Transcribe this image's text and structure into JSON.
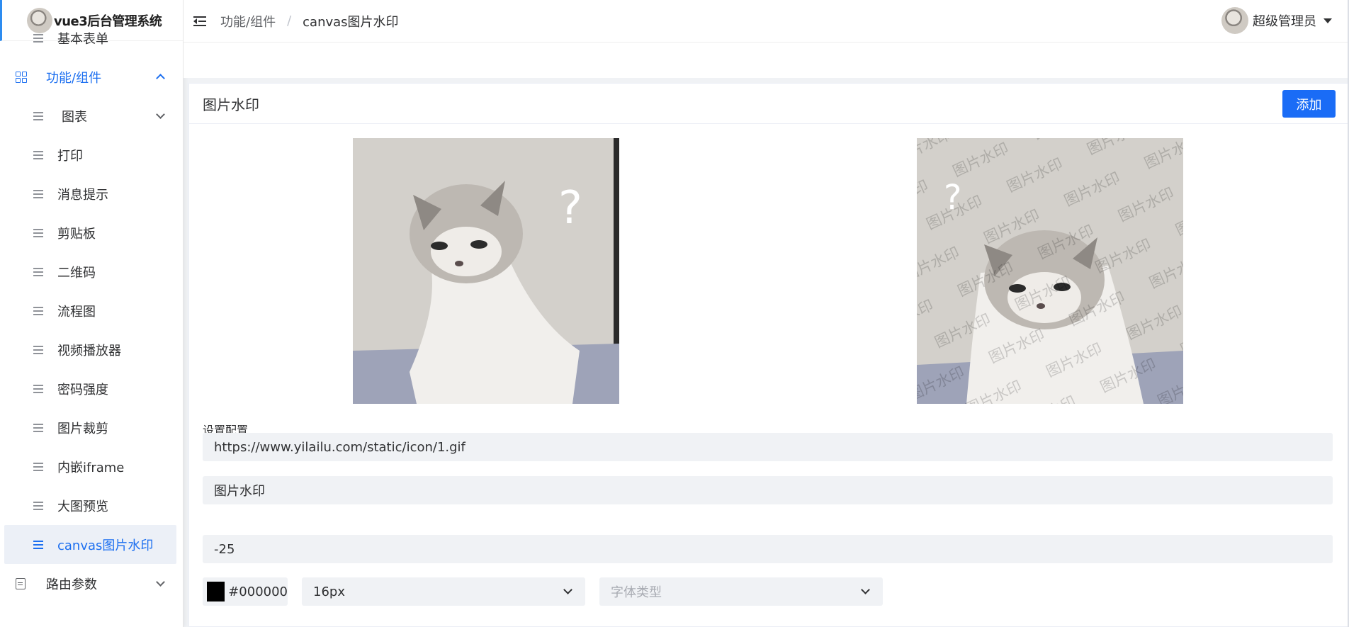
{
  "app": {
    "title": "vue3后台管理系统"
  },
  "sidebar": {
    "items": [
      {
        "label": "基本表单"
      },
      {
        "label": "功能/组件"
      },
      {
        "label": "图表"
      },
      {
        "label": "打印"
      },
      {
        "label": "消息提示"
      },
      {
        "label": "剪贴板"
      },
      {
        "label": "二维码"
      },
      {
        "label": "流程图"
      },
      {
        "label": "视频播放器"
      },
      {
        "label": "密码强度"
      },
      {
        "label": "图片裁剪"
      },
      {
        "label": "内嵌iframe"
      },
      {
        "label": "大图预览"
      },
      {
        "label": "canvas图片水印"
      },
      {
        "label": "路由参数"
      }
    ]
  },
  "header": {
    "breadcrumb": [
      "功能/组件",
      "/",
      "canvas图片水印"
    ],
    "user": "超级管理员"
  },
  "card": {
    "title": "图片水印",
    "add_label": "添加",
    "watermark_text": "图片水印",
    "config_label": "设置配置",
    "fields": {
      "url": "https://www.yilailu.com/static/icon/1.gif",
      "text": "图片水印",
      "rotate": "-25",
      "color": "#000000",
      "font_size": "16px",
      "font_family_placeholder": "字体类型"
    }
  },
  "colors": {
    "accent": "#1c6ff0",
    "button": "#1a6cf6",
    "swatch": "#000000"
  }
}
